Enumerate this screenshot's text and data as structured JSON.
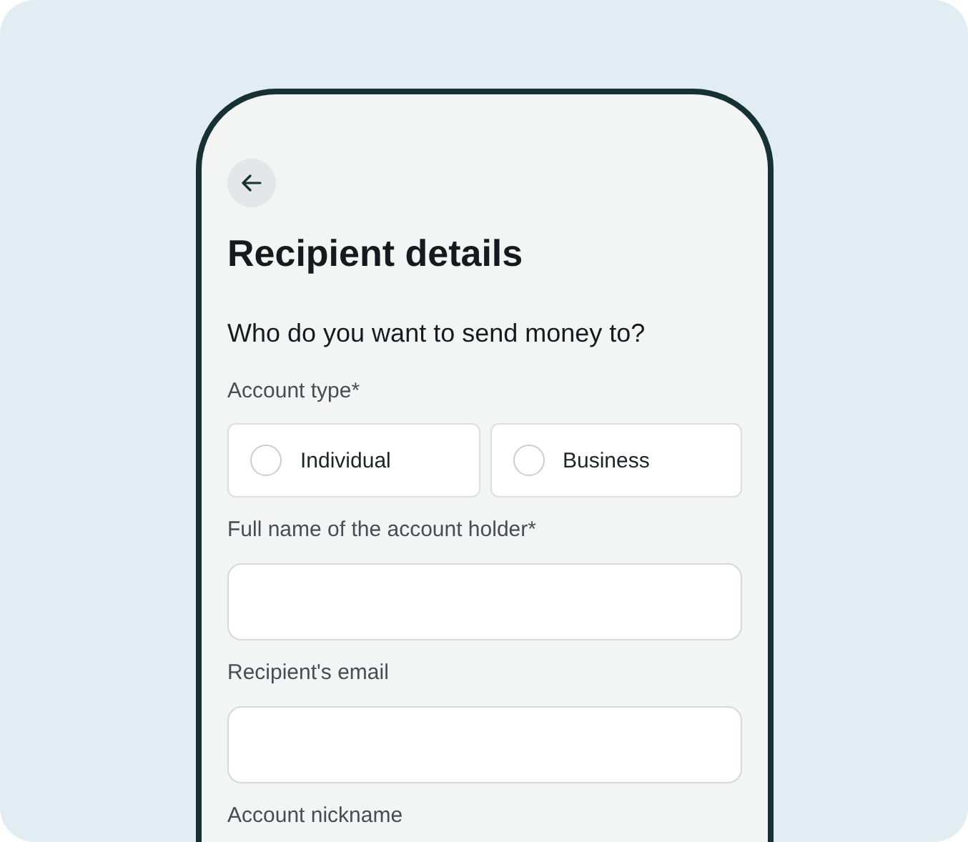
{
  "header": {
    "title": "Recipient details"
  },
  "question": "Who do you want to send money to?",
  "form": [
    {
      "kind": "radio_group",
      "label": "Account type*",
      "options": [
        {
          "label": "Individual",
          "selected": false
        },
        {
          "label": "Business",
          "selected": false
        }
      ]
    },
    {
      "kind": "text",
      "label": "Full name of the account holder*"
    },
    {
      "kind": "text",
      "label": "Recipient's email"
    },
    {
      "kind": "label_only",
      "label": "Account nickname"
    }
  ]
}
